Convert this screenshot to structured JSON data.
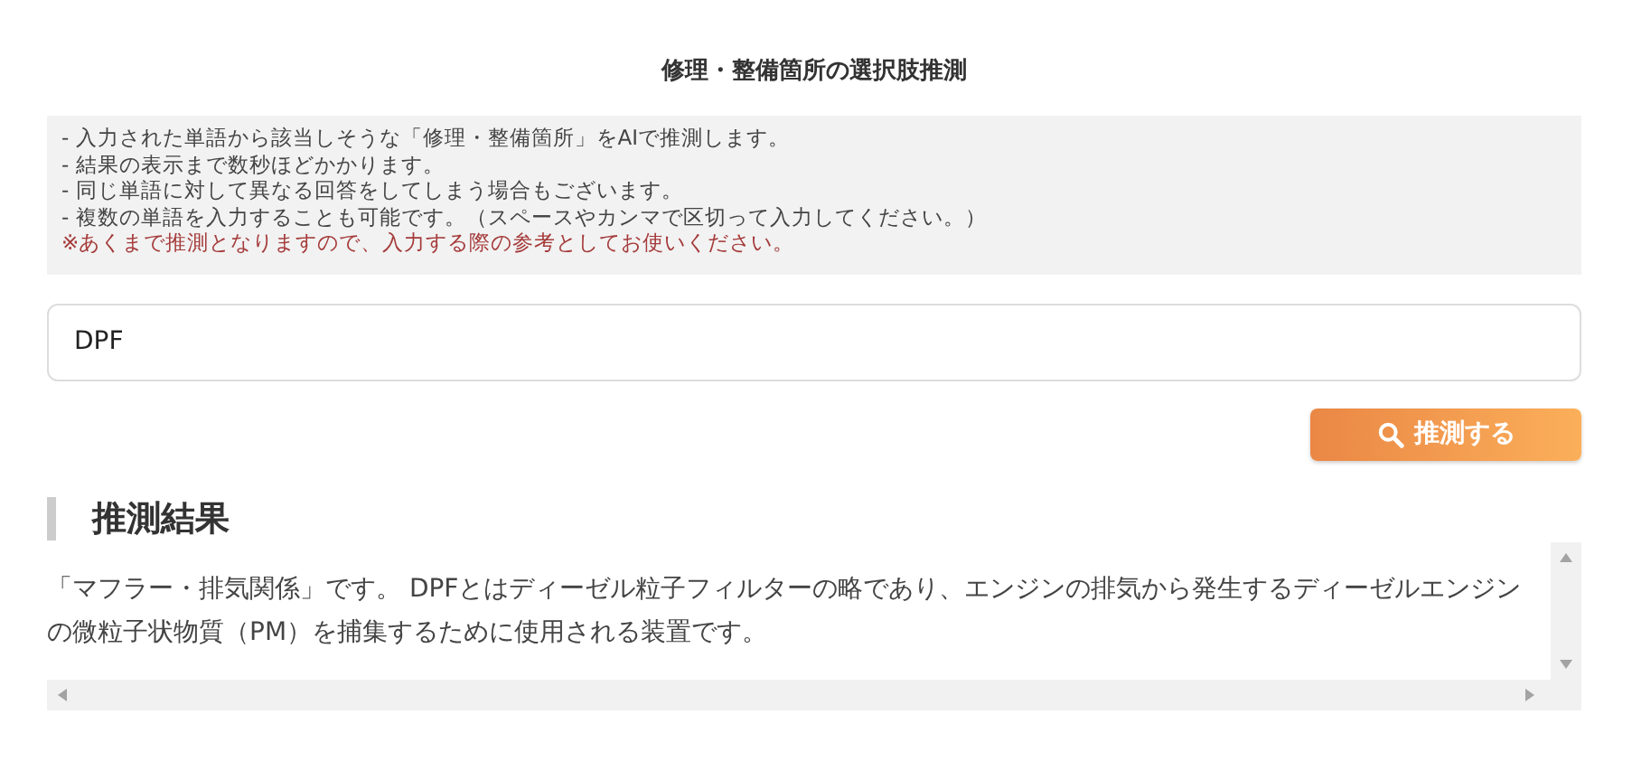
{
  "title": "修理・整備箇所の選択肢推測",
  "notes": [
    {
      "kind": "note",
      "text": "- 入力された単語から該当しそうな「修理・整備箇所」をAIで推測します。"
    },
    {
      "kind": "note",
      "text": "- 結果の表示まで数秒ほどかかります。"
    },
    {
      "kind": "note",
      "text": "- 同じ単語に対して異なる回答をしてしまう場合もございます。"
    },
    {
      "kind": "note",
      "text": "- 複数の単語を入力することも可能です。（スペースやカンマで区切って入力してください。）"
    },
    {
      "kind": "warning",
      "text": "※あくまで推測となりますので、入力する際の参考としてお使いください。"
    }
  ],
  "search_field": {
    "value": "DPF"
  },
  "search_button": {
    "label": "推測する"
  },
  "result": {
    "heading": "推測結果",
    "text": "「マフラー・排気関係」です。 DPFとはディーゼル粒子フィルターの略であり、エンジンの排気から発生するディーゼルエンジンの微粒子状物質（PM）を捕集するために使用される装置です。"
  }
}
